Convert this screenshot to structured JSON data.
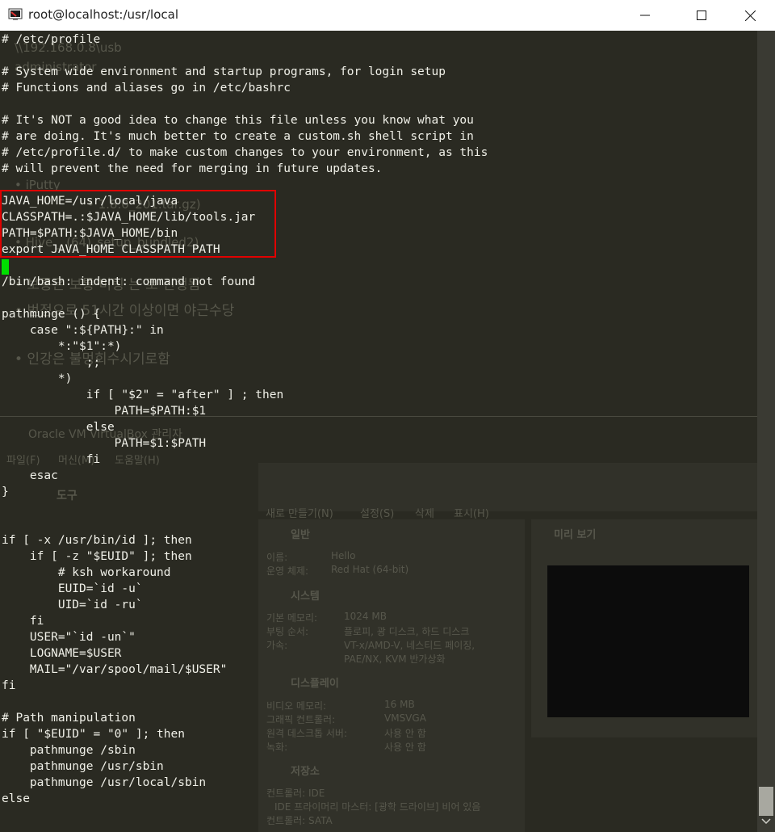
{
  "window": {
    "title": "root@localhost:/usr/local",
    "minimize_label": "minimize",
    "maximize_label": "maximize",
    "close_label": "close"
  },
  "terminal": {
    "lines": [
      "# /etc/profile",
      "",
      "# System wide environment and startup programs, for login setup",
      "# Functions and aliases go in /etc/bashrc",
      "",
      "# It's NOT a good idea to change this file unless you know what you",
      "# are doing. It's much better to create a custom.sh shell script in",
      "# /etc/profile.d/ to make custom changes to your environment, as this",
      "# will prevent the need for merging in future updates.",
      "",
      "JAVA_HOME=/usr/local/java",
      "CLASSPATH=.:$JAVA_HOME/lib/tools.jar",
      "PATH=$PATH:$JAVA_HOME/bin",
      "export JAVA_HOME CLASSPATH PATH",
      "",
      "/bin/bash: indent: command not found",
      "",
      "pathmunge () {",
      "    case \":${PATH}:\" in",
      "        *:\"$1\":*)",
      "            ;;",
      "        *)",
      "            if [ \"$2\" = \"after\" ] ; then",
      "                PATH=$PATH:$1",
      "            else",
      "                PATH=$1:$PATH",
      "            fi",
      "    esac",
      "}",
      "",
      "",
      "if [ -x /usr/bin/id ]; then",
      "    if [ -z \"$EUID\" ]; then",
      "        # ksh workaround",
      "        EUID=`id -u`",
      "        UID=`id -ru`",
      "    fi",
      "    USER=\"`id -un`\"",
      "    LOGNAME=$USER",
      "    MAIL=\"/var/spool/mail/$USER\"",
      "fi",
      "",
      "# Path manipulation",
      "if [ \"$EUID\" = \"0\" ]; then",
      "    pathmunge /sbin",
      "    pathmunge /usr/sbin",
      "    pathmunge /usr/local/sbin",
      "else"
    ]
  },
  "background_ghost": {
    "notes": [
      "\\\\192.168.0.8\\usb",
      "administrator",
      "• iPutty",
      "• 1.8.0_201.tar.gz)",
      "• Hive _ (64)_setup_bundled2)",
      "• 보통은 보통 미팅 는 로 진행됨",
      "• 번정으로 51시간 이상이면 야근수당",
      "• 인강은 불멍회수시기로함"
    ],
    "virtualbox": {
      "title": "Oracle VM VirtualBox 관리자",
      "menu": [
        "파일(F)",
        "머신(M)",
        "도움말(H)"
      ],
      "tools_label": "도구",
      "toolbar": [
        "새로 만들기(N)",
        "설정(S)",
        "삭제",
        "표시(H)"
      ],
      "vm_name": "Hello",
      "sections": {
        "general": "일반",
        "name_label": "이름:",
        "name_value": "Hello",
        "os_label": "운영 체제:",
        "os_value": "Red Hat (64-bit)",
        "system": "시스템",
        "memory_label": "기본 메모리:",
        "memory_value": "1024 MB",
        "boot_label": "부팅 순서:",
        "boot_value": "플로피, 광 디스크, 하드 디스크",
        "accel_label": "가속:",
        "accel_value": "VT-x/AMD-V, 네스티드 페이징, PAE/NX, KVM 반가상화",
        "display": "디스플레이",
        "vram_label": "비디오 메모리:",
        "vram_value": "16 MB",
        "gfx_label": "그래픽 컨트롤러:",
        "gfx_value": "VMSVGA",
        "rdp_label": "원격 데스크톱 서버:",
        "rdp_value": "사용 안 함",
        "rec_label": "녹화:",
        "rec_value": "사용 안 함",
        "storage": "저장소",
        "ctrl_ide": "컨트롤러: IDE",
        "ide_master": "IDE 프라이머리 마스터:  [광학 드라이브] 비어 있음",
        "ctrl_sata": "컨트롤러: SATA",
        "preview": "미리 보기"
      }
    }
  },
  "colors": {
    "terminal_bg": "#2a2a22",
    "terminal_fg": "#f0f0e8",
    "highlight_border": "#e00000",
    "cursor": "#00e000"
  }
}
